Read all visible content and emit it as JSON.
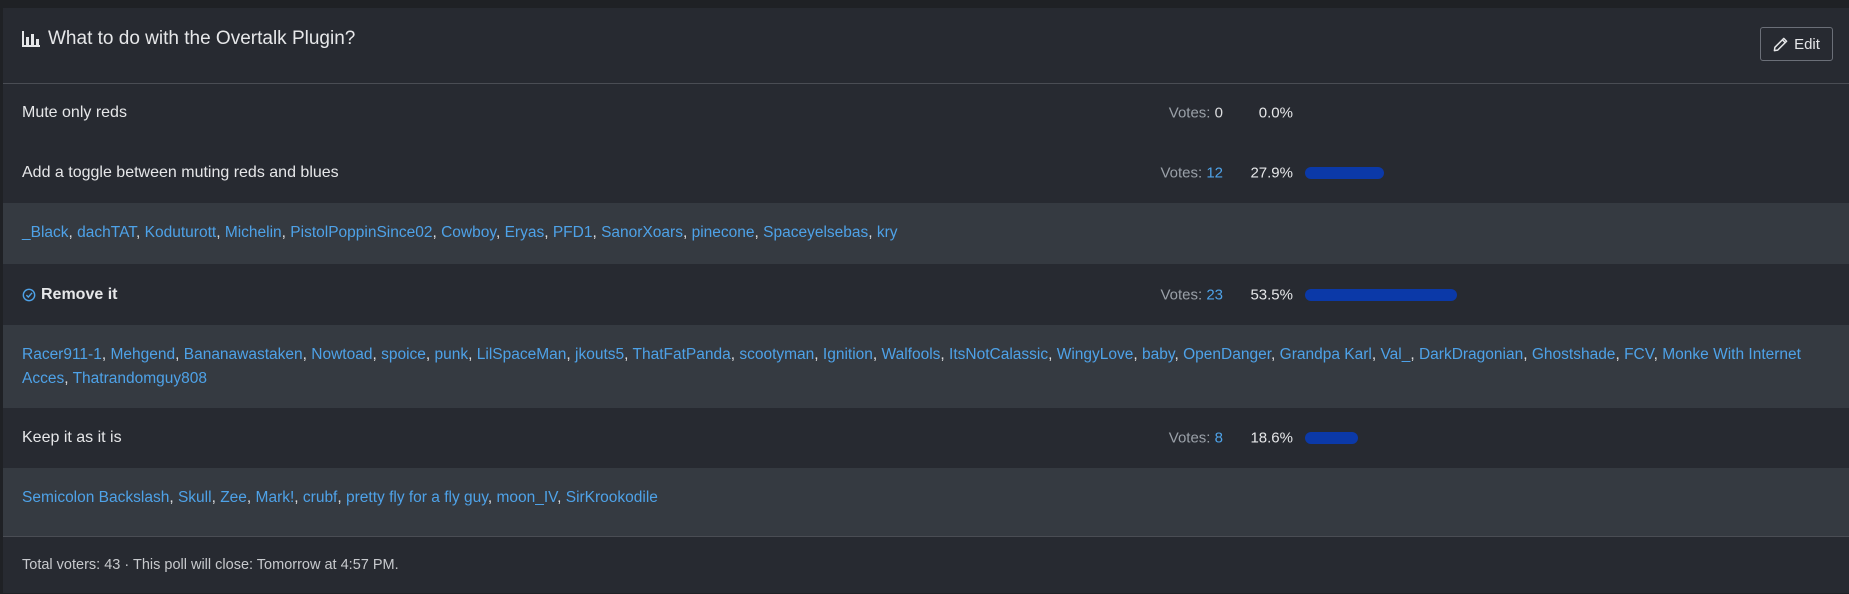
{
  "poll": {
    "title": "What to do with the Overtalk Plugin?",
    "edit_label": "Edit",
    "votes_label": "Votes: ",
    "options": [
      {
        "label": "Mute only reds",
        "votes": "0",
        "percent": "0.0%",
        "fraction": 0.0,
        "selected": false,
        "voters": []
      },
      {
        "label": "Add a toggle between muting reds and blues",
        "votes": "12",
        "percent": "27.9%",
        "fraction": 0.279,
        "selected": false,
        "voters": [
          "_Black",
          "dachTAT",
          "Koduturott",
          "Michelin",
          "PistolPoppinSince02",
          "Cowboy",
          "Eryas",
          "PFD1",
          "SanorXoars",
          "pinecone",
          "Spaceyelsebas",
          "kry"
        ]
      },
      {
        "label": "Remove it",
        "votes": "23",
        "percent": "53.5%",
        "fraction": 0.535,
        "selected": true,
        "voters": [
          "Racer911-1",
          "Mehgend",
          "Bananawastaken",
          "Nowtoad",
          "spoice",
          "punk",
          "LilSpaceMan",
          "jkouts5",
          "ThatFatPanda",
          "scootyman",
          "Ignition",
          "Walfools",
          "ItsNotCalassic",
          "WingyLove",
          "baby",
          "OpenDanger",
          "Grandpa Karl",
          "Val_",
          "DarkDragonian",
          "Ghostshade",
          "FCV",
          "Monke With Internet Acces",
          "Thatrandomguy808"
        ]
      },
      {
        "label": "Keep it as it is",
        "votes": "8",
        "percent": "18.6%",
        "fraction": 0.186,
        "selected": false,
        "voters": [
          "Semicolon Backslash",
          "Skull",
          "Zee",
          "Mark!",
          "crubf",
          "pretty fly for a fly guy",
          "moon_IV",
          "SirKrookodile"
        ]
      }
    ],
    "footer": {
      "total_label": "Total voters:",
      "total": "43",
      "close_text": "· This poll will close: Tomorrow at 4:57 PM."
    }
  },
  "colors": {
    "accent": "#4ea2e8",
    "bar": "#0b39a8",
    "background": "#272a31",
    "voters_background": "#353a41"
  }
}
